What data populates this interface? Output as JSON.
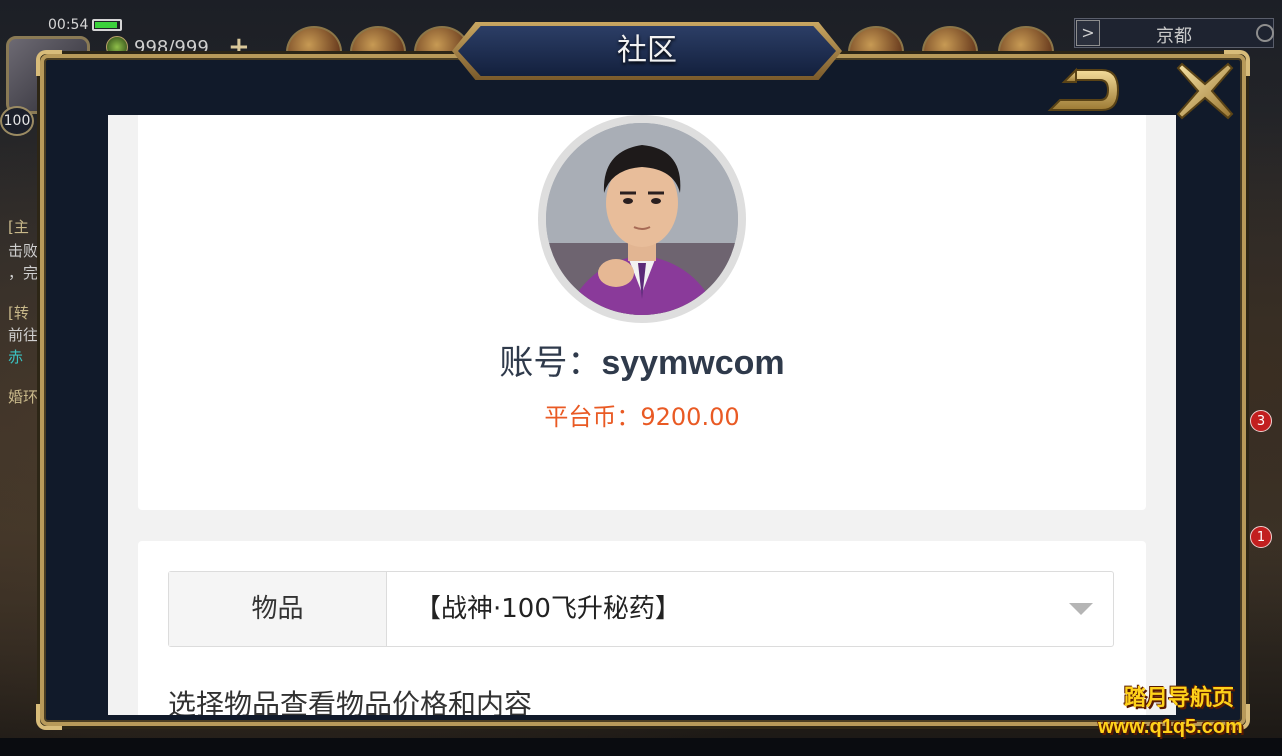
{
  "status_bar": {
    "time": "00:54"
  },
  "game_hud": {
    "energy": "998/999",
    "plus_label": "+",
    "level": "100",
    "city_arrow": ">",
    "city": "京都",
    "left_quests": [
      "[主",
      "击败",
      "，完",
      "[转",
      "前往",
      "赤",
      "婚环"
    ],
    "side_badges": [
      "3",
      "1"
    ]
  },
  "modal": {
    "title": "社区",
    "back_icon": "back-arrow-icon",
    "close_icon": "close-x-icon"
  },
  "profile": {
    "account_label": "账号：",
    "account_value": "syymwcom",
    "coins_label": "平台币：",
    "coins_value": "9200.00"
  },
  "item_selector": {
    "label": "物品",
    "selected": "【战神·100飞升秘药】",
    "hint": "选择物品查看物品价格和内容"
  },
  "watermark": {
    "line1": "踏月导航页",
    "line2": "www.q1q5.com"
  },
  "colors": {
    "frame_gold": "#b89a5a",
    "title_blue": "#13203d",
    "coins_orange": "#e95a24",
    "watermark_yellow": "#ffd21a"
  }
}
